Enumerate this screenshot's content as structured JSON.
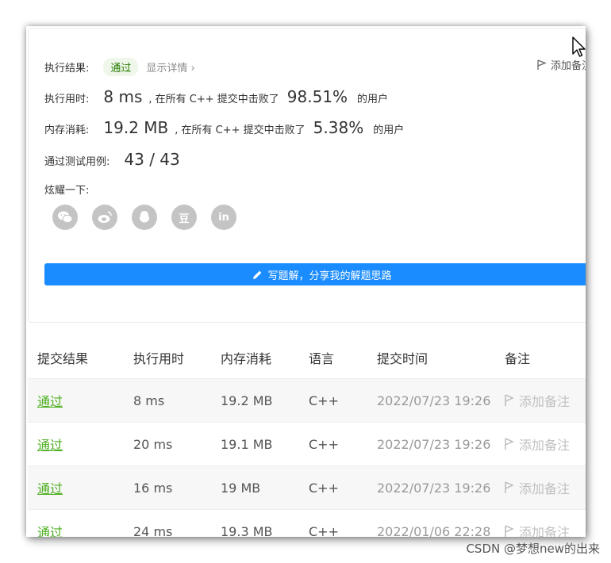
{
  "summary": {
    "result_label": "执行结果:",
    "result_status": "通过",
    "details_link": "显示详情 ›",
    "add_note": "添加备注",
    "runtime_label": "执行用时:",
    "runtime_value": "8 ms",
    "runtime_mid": ", 在所有 C++ 提交中击败了",
    "runtime_pct": "98.51%",
    "runtime_suffix": "的用户",
    "memory_label": "内存消耗:",
    "memory_value": "19.2 MB",
    "memory_mid": ", 在所有 C++ 提交中击败了",
    "memory_pct": "5.38%",
    "memory_suffix": "的用户",
    "tests_label": "通过测试用例:",
    "tests_value": "43 / 43",
    "share_label": "炫耀一下:",
    "share_icons": [
      "wechat-icon",
      "weibo-icon",
      "qq-icon",
      "douban-icon",
      "linkedin-icon"
    ],
    "douban_glyph": "豆",
    "linkedin_glyph": "in",
    "write_button": "写题解，分享我的解题思路"
  },
  "table": {
    "headers": [
      "提交结果",
      "执行用时",
      "内存消耗",
      "语言",
      "提交时间",
      "备注"
    ],
    "rows": [
      {
        "status": "通过",
        "runtime": "8 ms",
        "memory": "19.2 MB",
        "lang": "C++",
        "time": "2022/07/23 19:26",
        "note": "添加备注"
      },
      {
        "status": "通过",
        "runtime": "20 ms",
        "memory": "19.1 MB",
        "lang": "C++",
        "time": "2022/07/23 19:26",
        "note": "添加备注"
      },
      {
        "status": "通过",
        "runtime": "16 ms",
        "memory": "19 MB",
        "lang": "C++",
        "time": "2022/07/23 19:26",
        "note": "添加备注"
      },
      {
        "status": "通过",
        "runtime": "24 ms",
        "memory": "19.3 MB",
        "lang": "C++",
        "time": "2022/01/06 22:28",
        "note": "添加备注"
      }
    ]
  },
  "watermark": "CSDN @梦想new的出来",
  "colors": {
    "accent": "#1a8cff",
    "pass": "#4caf1f",
    "pill_bg": "#eef7ea"
  }
}
